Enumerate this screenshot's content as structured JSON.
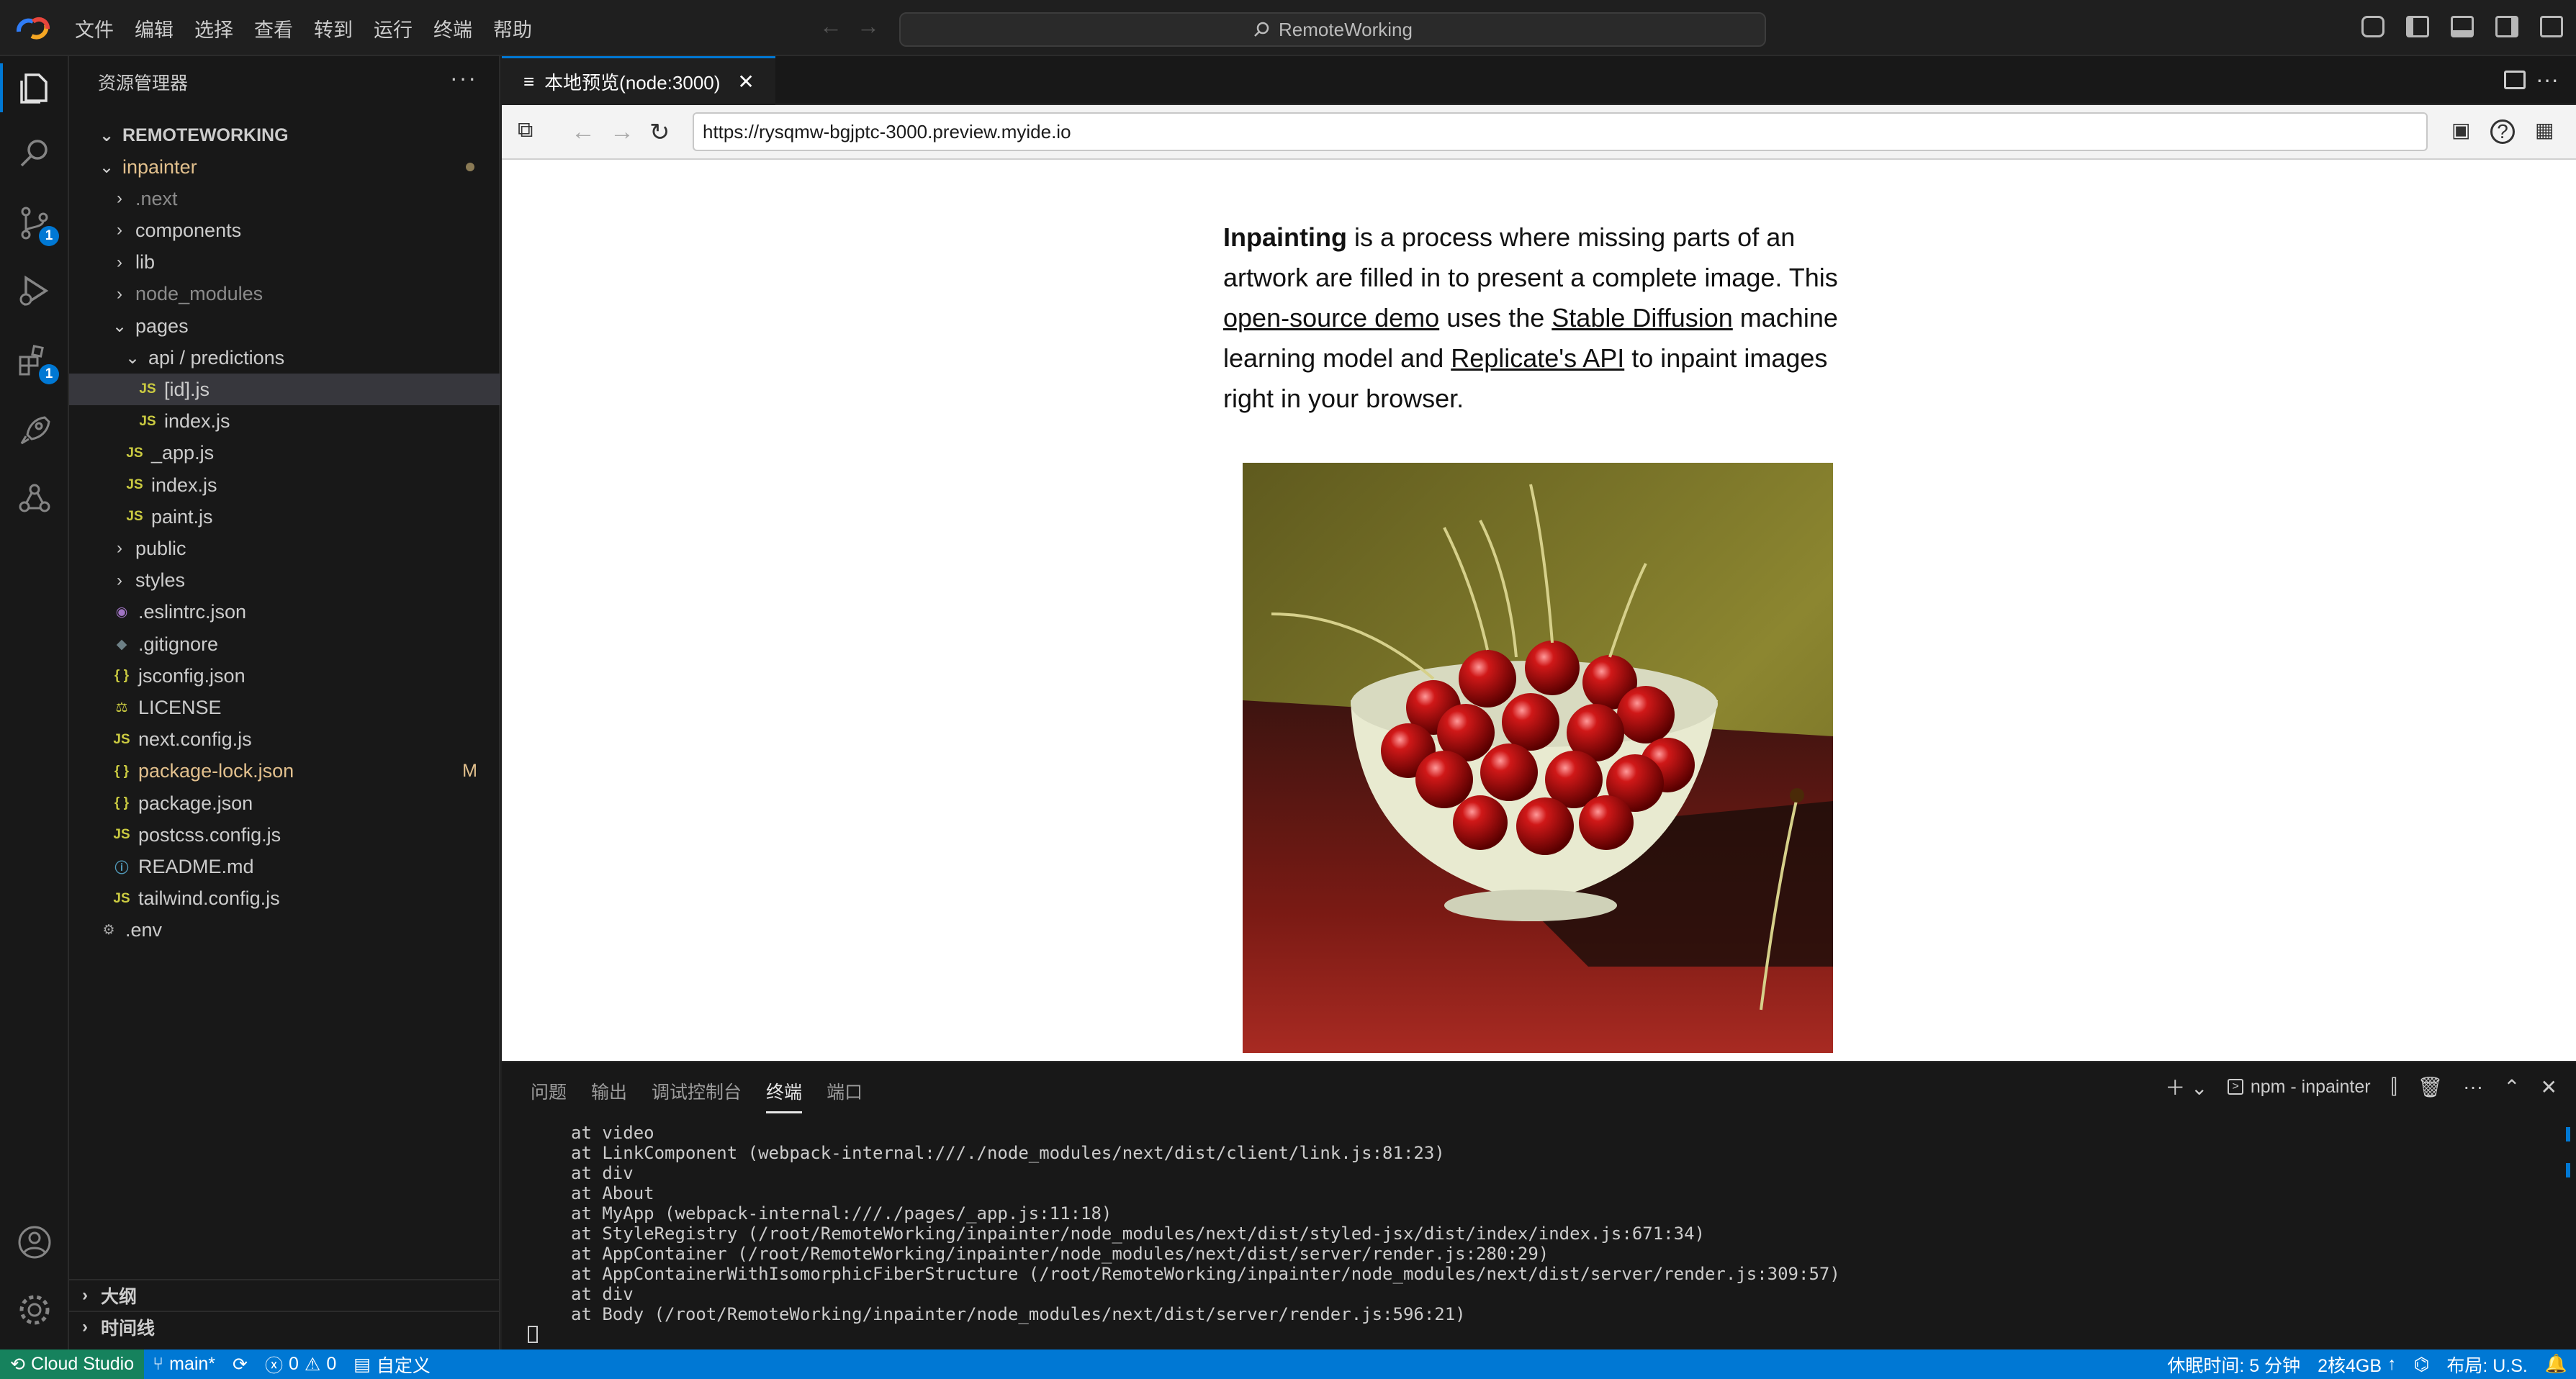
{
  "titlebar": {
    "menu": [
      "文件",
      "编辑",
      "选择",
      "查看",
      "转到",
      "运行",
      "终端",
      "帮助"
    ],
    "search_text": "RemoteWorking"
  },
  "activity_bar": {
    "badges": {
      "source_control": "1",
      "extensions": "1"
    }
  },
  "sidebar": {
    "title": "资源管理器",
    "root": "REMOTEWORKING",
    "items": [
      {
        "label": "inpainter",
        "kind": "folder-open",
        "level": 0,
        "dot": true
      },
      {
        "label": ".next",
        "kind": "folder",
        "level": 1,
        "dim": true
      },
      {
        "label": "components",
        "kind": "folder",
        "level": 1
      },
      {
        "label": "lib",
        "kind": "folder",
        "level": 1
      },
      {
        "label": "node_modules",
        "kind": "folder",
        "level": 1,
        "dim": true
      },
      {
        "label": "pages",
        "kind": "folder-open",
        "level": 1
      },
      {
        "label": "api / predictions",
        "kind": "folder-open",
        "level": 2
      },
      {
        "label": "[id].js",
        "kind": "js",
        "level": 3,
        "selected": true
      },
      {
        "label": "index.js",
        "kind": "js",
        "level": 3
      },
      {
        "label": "_app.js",
        "kind": "js",
        "level": 2
      },
      {
        "label": "index.js",
        "kind": "js",
        "level": 2
      },
      {
        "label": "paint.js",
        "kind": "js",
        "level": 2
      },
      {
        "label": "public",
        "kind": "folder",
        "level": 1
      },
      {
        "label": "styles",
        "kind": "folder",
        "level": 1
      },
      {
        "label": ".eslintrc.json",
        "kind": "eslint",
        "level": 1
      },
      {
        "label": ".gitignore",
        "kind": "git",
        "level": 1
      },
      {
        "label": "jsconfig.json",
        "kind": "json",
        "level": 1
      },
      {
        "label": "LICENSE",
        "kind": "license",
        "level": 1
      },
      {
        "label": "next.config.js",
        "kind": "js",
        "level": 1
      },
      {
        "label": "package-lock.json",
        "kind": "json",
        "level": 1,
        "modified": "M"
      },
      {
        "label": "package.json",
        "kind": "json",
        "level": 1
      },
      {
        "label": "postcss.config.js",
        "kind": "js",
        "level": 1
      },
      {
        "label": "README.md",
        "kind": "info",
        "level": 1
      },
      {
        "label": "tailwind.config.js",
        "kind": "js",
        "level": 1
      },
      {
        "label": ".env",
        "kind": "gear",
        "level": 0
      }
    ],
    "outline": "大纲",
    "timeline": "时间线"
  },
  "editor": {
    "tab_label": "本地预览(node:3000)",
    "url": "https://rysqmw-bgjptc-3000.preview.myide.io",
    "content": {
      "bold": "Inpainting",
      "t1": " is a process where missing parts of an artwork are filled in to present a complete image. This ",
      "link1": "open-source demo",
      "t2": " uses the ",
      "link2": "Stable Diffusion",
      "t3": " machine learning model and ",
      "link3": "Replicate's API",
      "t4": " to inpaint images right in your browser."
    }
  },
  "panel": {
    "tabs": [
      "问题",
      "输出",
      "调试控制台",
      "终端",
      "端口"
    ],
    "active_tab": "终端",
    "terminal_name": "npm - inpainter",
    "terminal_lines": [
      "at video",
      "at LinkComponent (webpack-internal:///./node_modules/next/dist/client/link.js:81:23)",
      "at div",
      "at About",
      "at MyApp (webpack-internal:///./pages/_app.js:11:18)",
      "at StyleRegistry (/root/RemoteWorking/inpainter/node_modules/next/dist/styled-jsx/dist/index/index.js:671:34)",
      "at AppContainer (/root/RemoteWorking/inpainter/node_modules/next/dist/server/render.js:280:29)",
      "at AppContainerWithIsomorphicFiberStructure (/root/RemoteWorking/inpainter/node_modules/next/dist/server/render.js:309:57)",
      "at div",
      "at Body (/root/RemoteWorking/inpainter/node_modules/next/dist/server/render.js:596:21)"
    ]
  },
  "statusbar": {
    "remote": "Cloud Studio",
    "branch": "main*",
    "errors": "0",
    "warnings": "0",
    "custom": "自定义",
    "idle": "休眠时间: 5 分钟",
    "spec": "2核4GB",
    "layout": "布局: U.S."
  },
  "colors": {
    "accent": "#0078d4",
    "sidebar_bg": "#181818",
    "editor_bg": "#1f1f1f"
  }
}
